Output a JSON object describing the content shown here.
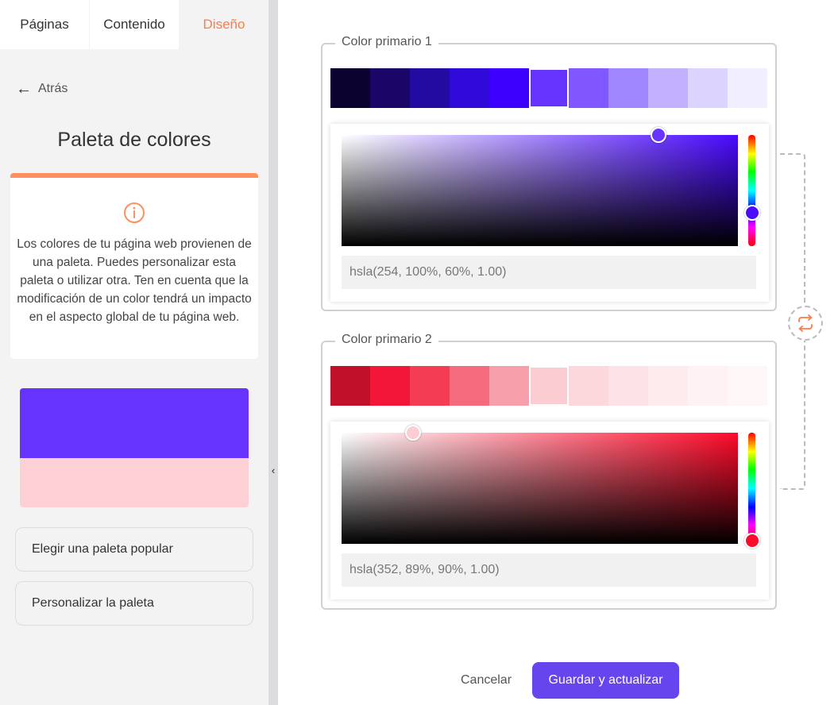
{
  "sidebar": {
    "tabs": [
      {
        "label": "Páginas"
      },
      {
        "label": "Contenido"
      },
      {
        "label": "Diseño",
        "active": true
      }
    ],
    "back_label": "Atrás",
    "title": "Paleta de colores",
    "info_text": "Los colores de tu página web provienen de una paleta. Puedes personalizar esta paleta o utilizar otra. Ten en cuenta que la modificación de un color tendrá un impacto en el aspecto global de tu página web.",
    "preview": {
      "primary": "#6633ff",
      "secondary": "#fdd0d6"
    },
    "buttons": {
      "popular": "Elegir una paleta popular",
      "customize": "Personalizar la paleta"
    }
  },
  "primary1": {
    "legend": "Color primario 1",
    "swatches": [
      "#0b0230",
      "#1a0666",
      "#230aa0",
      "#2f0ad8",
      "#3d00ff",
      "#6633ff",
      "#8158ff",
      "#a086ff",
      "#c1b1ff",
      "#ddd3ff",
      "#f1eeff"
    ],
    "selected_index": 5,
    "hue_color": "#4a0aff",
    "knob_color": "#6633ff",
    "sl_knob": {
      "s": 0.8,
      "v": 1.0
    },
    "hue_position": 0.7,
    "hsla": "hsla(254, 100%, 60%, 1.00)"
  },
  "primary2": {
    "legend": "Color primario 2",
    "swatches": [
      "#c1102a",
      "#f21638",
      "#f43d55",
      "#f56b7e",
      "#f7a0ab",
      "#fbcdd3",
      "#fcd8dd",
      "#fde2e6",
      "#feebee",
      "#fef2f4",
      "#fff6f7"
    ],
    "selected_index": 5,
    "hue_color": "#ff0a2a",
    "knob_color": "#fccdd3",
    "sl_knob": {
      "s": 0.18,
      "v": 1.0
    },
    "hue_position": 0.97,
    "hsla": "hsla(352, 89%, 90%, 1.00)"
  },
  "footer": {
    "cancel": "Cancelar",
    "save": "Guardar y actualizar"
  },
  "colors": {
    "accent": "#ff7a45",
    "brand": "#6644ee"
  }
}
